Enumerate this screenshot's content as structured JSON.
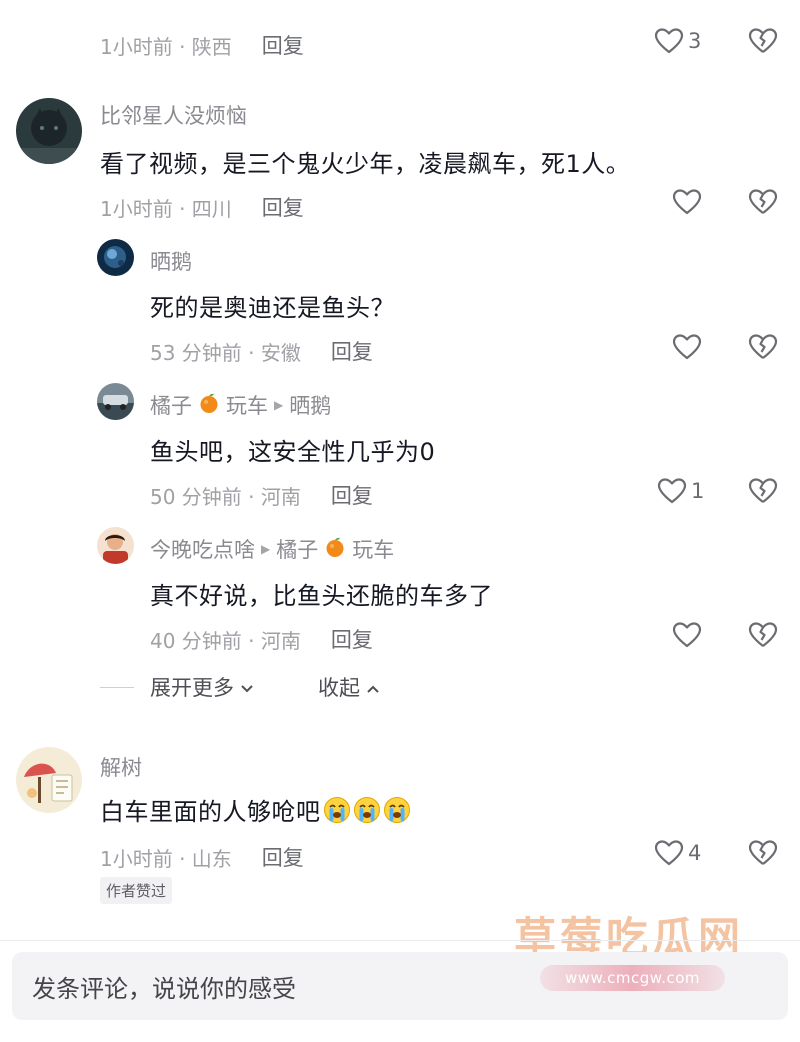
{
  "top_comment_meta": {
    "time_location": "1小时前 · 陕西",
    "reply": "回复",
    "like_count": "3"
  },
  "comments": [
    {
      "user": "比邻星人没烦恼",
      "text": "看了视频，是三个鬼火少年，凌晨飙车，死1人。",
      "time_location": "1小时前 · 四川",
      "reply": "回复",
      "like_count": ""
    },
    {
      "user": "解树",
      "text": "白车里面的人够呛吧",
      "emoji": [
        "crying-face",
        "crying-face",
        "crying-face"
      ],
      "time_location": "1小时前 · 山东",
      "reply": "回复",
      "like_count": "4",
      "badge": "作者赞过"
    }
  ],
  "replies": [
    {
      "user": "晒鹅",
      "reply_to": "",
      "text": "死的是奥迪还是鱼头？",
      "time_location": "53 分钟前 · 安徽",
      "reply": "回复",
      "like_count": ""
    },
    {
      "user": "橘子",
      "user_suffix": "玩车",
      "reply_to": "晒鹅",
      "text": "鱼头吧，这安全性几乎为0",
      "time_location": "50 分钟前 · 河南",
      "reply": "回复",
      "like_count": "1"
    },
    {
      "user": "今晚吃点啥",
      "reply_to": "橘子",
      "reply_to_suffix": "玩车",
      "text": "真不好说，比鱼头还脆的车多了",
      "time_location": "40 分钟前 · 河南",
      "reply": "回复",
      "like_count": ""
    }
  ],
  "thread_controls": {
    "expand_more": "展开更多",
    "collapse": "收起"
  },
  "input": {
    "placeholder": "发条评论，说说你的感受"
  },
  "watermark": {
    "text": "草莓吃瓜网",
    "url": "www.cmcgw.com"
  },
  "colors": {
    "primary_text": "#161823",
    "secondary_text": "#8a8b91",
    "icon_stroke": "#6b6c72",
    "input_bg": "#f3f3f5"
  }
}
